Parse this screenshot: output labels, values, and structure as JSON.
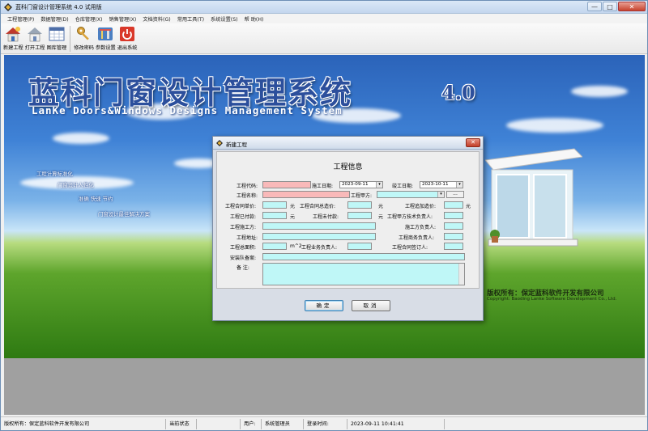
{
  "window": {
    "title": "蓝科门窗设计管理系统 4.0 试用版",
    "close": "✕",
    "maximize": "□",
    "minimize": "—"
  },
  "menu": [
    "工程管理(P)",
    "数据管理(D)",
    "仓库管理(X)",
    "销售管理(X)",
    "文档资料(G)",
    "常用工具(T)",
    "系统设置(S)",
    "帮 助(H)"
  ],
  "toolbar": {
    "new_project": "新建工程",
    "open_project": "打开工程",
    "gallery": "图库管理",
    "change_password": "修改密码",
    "settings": "参数设置",
    "exit": "退出系统"
  },
  "splash": {
    "title": "蓝科门窗设计管理系统",
    "version": "4.0",
    "subtitle": "LanKe Doors&Windows Designs Management System",
    "slogans": [
      "工程计算标准化",
      "门窗设计人性化",
      "准确 快速 节约",
      "门窗设计最佳解决方案"
    ],
    "copyright": "版权所有：保定蓝科软件开发有限公司",
    "copyright_en": "Copyright: Baoding Lanke Software Development Co., Ltd."
  },
  "dialog": {
    "title": "新建工程",
    "close": "✕",
    "heading": "工程信息",
    "labels": {
      "code": "工程代码:",
      "start_date": "施工日期:",
      "end_date": "竣工日期:",
      "name": "工程名称:",
      "party_a": "工程甲方:",
      "unit_price": "工程合同单价:",
      "total_price": "工程合同总造价:",
      "add_price": "工程追加造价:",
      "paid": "工程已付款:",
      "unpaid": "工程未付款:",
      "party_a_tech": "工程甲方技术负责人:",
      "construction": "工程施工方:",
      "construction_lead": "施工方负责人:",
      "address": "工程地址:",
      "business_lead": "工程商务负责人:",
      "area": "工程总面积:",
      "sales_lead": "工程业务负责人:",
      "contract_signer": "工程合同签订人:",
      "install_team": "安装队备案:",
      "remark": "备    注:"
    },
    "values": {
      "code": "",
      "start_date": "2023-09-11",
      "end_date": "2023-10-11",
      "name": "",
      "party_a": "",
      "unit_price": "",
      "total_price": "",
      "add_price": "",
      "paid": "",
      "unpaid": "",
      "party_a_tech": "",
      "construction": "",
      "construction_lead": "",
      "address": "",
      "business_lead": "",
      "area": "",
      "sales_lead": "",
      "contract_signer": "",
      "install_team": "",
      "remark": ""
    },
    "units": {
      "yuan": "元",
      "sqm": "m^2"
    },
    "ellipsis": "...",
    "ok": "确定",
    "cancel": "取消"
  },
  "status": {
    "owner": "版权所有：保定蓝科软件开发有限公司",
    "current_status_label": "当前状态",
    "current_status": "",
    "user_label": "用户:",
    "user": "系统管理员",
    "login_time_label": "登录时间:",
    "login_time": "2023-09-11 10:41:41"
  }
}
